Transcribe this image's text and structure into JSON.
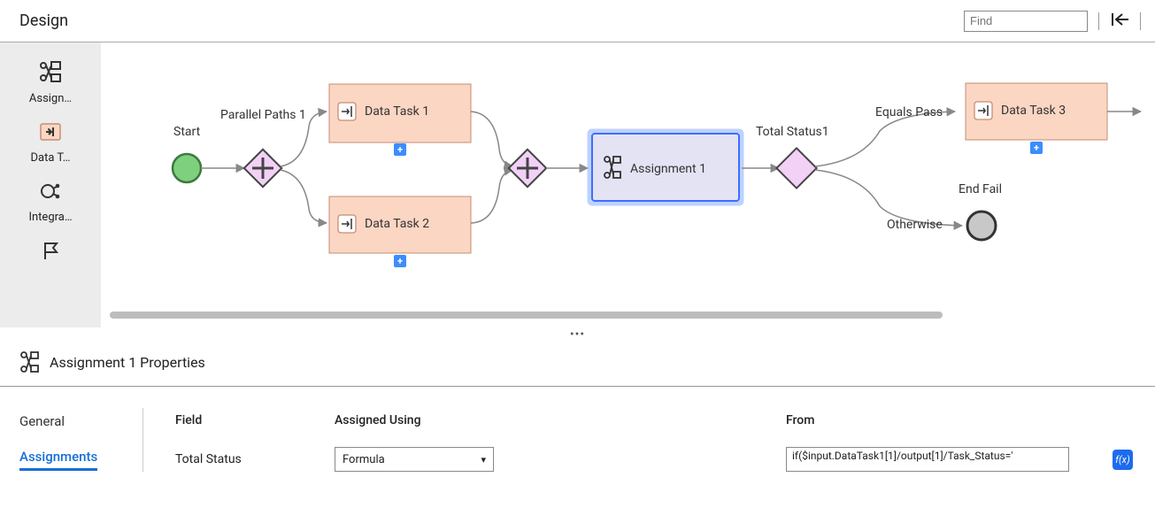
{
  "header": {
    "title": "Design",
    "find_placeholder": "Find"
  },
  "palette": [
    {
      "icon": "assignment",
      "label": "Assign…"
    },
    {
      "icon": "data-task",
      "label": "Data T…"
    },
    {
      "icon": "integration",
      "label": "Integra…"
    },
    {
      "icon": "flag",
      "label": ""
    }
  ],
  "flow": {
    "start_label": "Start",
    "parallel_label": "Parallel Paths 1",
    "task1_label": "Data Task 1",
    "task2_label": "Data Task 2",
    "assignment_label": "Assignment 1",
    "decision_label": "Total Status1",
    "equals_label": "Equals Pass",
    "otherwise_label": "Otherwise",
    "task3_label": "Data Task 3",
    "end_label": "End Fail"
  },
  "properties": {
    "title": "Assignment 1 Properties",
    "tabs": [
      "General",
      "Assignments"
    ],
    "active_tab": 1,
    "columns": [
      "Field",
      "Assigned Using",
      "From"
    ],
    "row": {
      "field": "Total Status",
      "assigned_using": "Formula",
      "from": "if($input.DataTask1[1]/output[1]/Task_Status='"
    }
  }
}
